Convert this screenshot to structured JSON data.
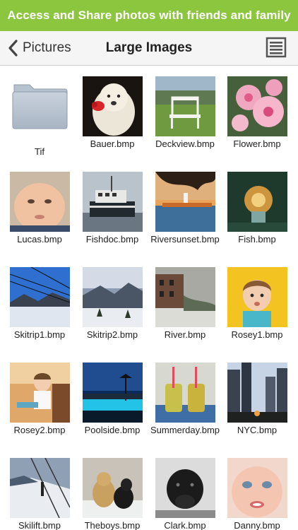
{
  "promo_banner": {
    "text": "Access and Share photos with friends and family"
  },
  "navbar": {
    "back_label": "Pictures",
    "title": "Large Images",
    "menu_icon": "list-menu-icon"
  },
  "colors": {
    "banner": "#8cc63f",
    "navbar_bg": "#f5f5f5"
  },
  "items": [
    {
      "label": "Tif",
      "kind": "folder"
    },
    {
      "label": "Bauer.bmp",
      "kind": "image"
    },
    {
      "label": "Deckview.bmp",
      "kind": "image"
    },
    {
      "label": "Flower.bmp",
      "kind": "image"
    },
    {
      "label": "Lucas.bmp",
      "kind": "image"
    },
    {
      "label": "Fishdoc.bmp",
      "kind": "image"
    },
    {
      "label": "Riversunset.bmp",
      "kind": "image"
    },
    {
      "label": "Fish.bmp",
      "kind": "image"
    },
    {
      "label": "Skitrip1.bmp",
      "kind": "image"
    },
    {
      "label": "Skitrip2.bmp",
      "kind": "image"
    },
    {
      "label": "River.bmp",
      "kind": "image"
    },
    {
      "label": "Rosey1.bmp",
      "kind": "image"
    },
    {
      "label": "Rosey2.bmp",
      "kind": "image"
    },
    {
      "label": "Poolside.bmp",
      "kind": "image"
    },
    {
      "label": "Summerday.bmp",
      "kind": "image"
    },
    {
      "label": "NYC.bmp",
      "kind": "image"
    },
    {
      "label": "Skilift.bmp",
      "kind": "image"
    },
    {
      "label": "Theboys.bmp",
      "kind": "image"
    },
    {
      "label": "Clark.bmp",
      "kind": "image"
    },
    {
      "label": "Danny.bmp",
      "kind": "image"
    }
  ]
}
